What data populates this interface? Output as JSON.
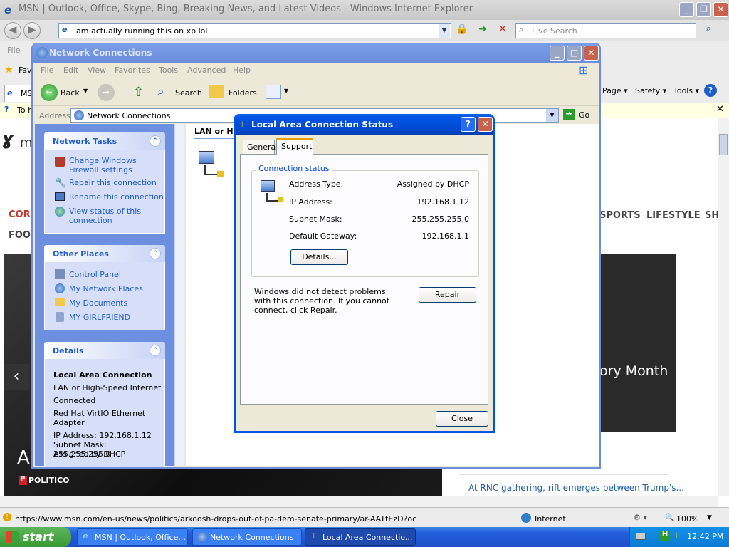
{
  "ie": {
    "title": "MSN | Outlook, Office, Skype, Bing, Breaking News, and Latest Videos - Windows Internet Explorer",
    "address": "am actually running this on xp lol",
    "search_placeholder": "Live Search",
    "menu": [
      "File"
    ],
    "fav_label": "Fav",
    "tab_label": "MS",
    "infobar_text": "To h",
    "command_bar": [
      "Page",
      "Safety",
      "Tools"
    ],
    "status_url": "https://www.msn.com/en-us/news/politics/arkoosh-drops-out-of-pa-dem-senate-primary/ar-AATtEzD?ocid=iehp&li=B",
    "zone": "Internet",
    "zoom": "100%"
  },
  "msn": {
    "logo": "m",
    "nav_left": "CORO",
    "nav_left2": "FOOD",
    "nav_right": [
      "SPORTS",
      "LIFESTYLE",
      "SH"
    ],
    "hero_text": "ory Month",
    "hero_letter": "A",
    "source": "POLITICO",
    "headline": "At RNC gathering, rift emerges between Trump's..."
  },
  "nc": {
    "title": "Network Connections",
    "menu": [
      "File",
      "Edit",
      "View",
      "Favorites",
      "Tools",
      "Advanced",
      "Help"
    ],
    "toolbar": {
      "back": "Back",
      "search": "Search",
      "folders": "Folders"
    },
    "address_label": "Address",
    "address_value": "Network Connections",
    "go": "Go",
    "list_header": "LAN or High",
    "network_tasks": {
      "title": "Network Tasks",
      "items": [
        "Change Windows Firewall settings",
        "Repair this connection",
        "Rename this connection",
        "View status of this connection"
      ]
    },
    "other_places": {
      "title": "Other Places",
      "items": [
        "Control Panel",
        "My Network Places",
        "My Documents",
        "MY GIRLFRIEND"
      ]
    },
    "details": {
      "title": "Details",
      "name": "Local Area Connection",
      "type": "LAN or High-Speed Internet",
      "status": "Connected",
      "adapter": "Red Hat VirtIO Ethernet Adapter",
      "ip": "IP Address: 192.168.1.12",
      "mask": "Subnet Mask: 255.255.255.0",
      "assigned": "Assigned by DHCP"
    }
  },
  "status": {
    "title": "Local Area Connection Status",
    "tabs": [
      "General",
      "Support"
    ],
    "group": "Connection status",
    "rows": [
      {
        "label": "Address Type:",
        "value": "Assigned by DHCP"
      },
      {
        "label": "IP Address:",
        "value": "192.168.1.12"
      },
      {
        "label": "Subnet Mask:",
        "value": "255.255.255.0"
      },
      {
        "label": "Default Gateway:",
        "value": "192.168.1.1"
      }
    ],
    "details_button": "Details...",
    "message": "Windows did not detect problems with this connection. If you cannot connect, click Repair.",
    "repair_button": "Repair",
    "close_button": "Close"
  },
  "taskbar": {
    "start": "start",
    "buttons": [
      "MSN | Outlook, Office...",
      "Network Connections",
      "Local Area Connectio..."
    ],
    "clock": "12:42 PM"
  },
  "colors": {
    "xp_blue": "#0054e3",
    "taskpane": "#6c8fe0",
    "link": "#215dc6",
    "start_green": "#3a9a33"
  }
}
